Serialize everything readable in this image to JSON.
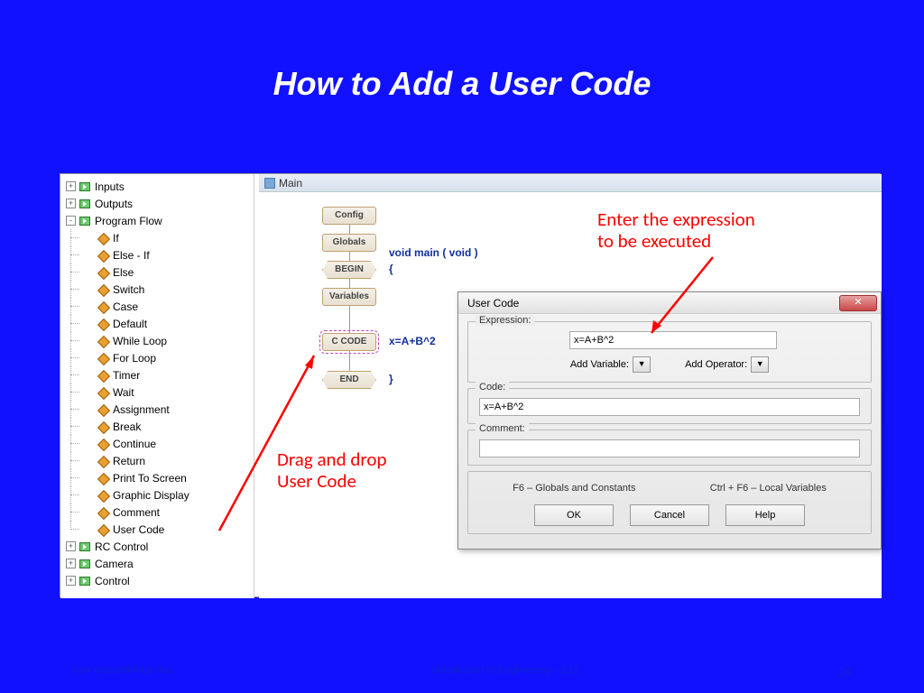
{
  "slide": {
    "title": "How to Add a User Code",
    "page_number": "24"
  },
  "footer": {
    "left": "Ken Youssefi/Ping Hsu",
    "center": "Introduction to Engineering – E10"
  },
  "tree": {
    "top": [
      {
        "label": "Inputs",
        "exp": "+"
      },
      {
        "label": "Outputs",
        "exp": "+"
      },
      {
        "label": "Program Flow",
        "exp": "-"
      }
    ],
    "flow_items": [
      "If",
      "Else - If",
      "Else",
      "Switch",
      "Case",
      "Default",
      "While Loop",
      "For Loop",
      "Timer",
      "Wait",
      "Assignment",
      "Break",
      "Continue",
      "Return",
      "Print To Screen",
      "Graphic Display",
      "Comment",
      "User Code"
    ],
    "bottom": [
      {
        "label": "RC Control",
        "exp": "+"
      },
      {
        "label": "Camera",
        "exp": "+"
      },
      {
        "label": "Control",
        "exp": "+"
      }
    ]
  },
  "main": {
    "title": "Main"
  },
  "flow": {
    "blocks": {
      "config": "Config",
      "globals": "Globals",
      "begin": "BEGIN",
      "variables": "Variables",
      "code": "C CODE",
      "end": "END"
    },
    "code_lines": {
      "sig": "void main ( void )",
      "open": "{",
      "expr": "x=A+B^2",
      "close": "}"
    }
  },
  "dialog": {
    "title": "User Code",
    "expression_label": "Expression:",
    "expression_value": "x=A+B^2",
    "add_variable": "Add Variable:",
    "add_operator": "Add Operator:",
    "code_label": "Code:",
    "code_value": "x=A+B^2",
    "comment_label": "Comment:",
    "comment_value": "",
    "hint1": "F6 – Globals and Constants",
    "hint2": "Ctrl + F6 – Local Variables",
    "ok": "OK",
    "cancel": "Cancel",
    "help": "Help"
  },
  "annot": {
    "enter": "Enter the expression\nto be executed",
    "drag": "Drag and drop\nUser Code"
  }
}
